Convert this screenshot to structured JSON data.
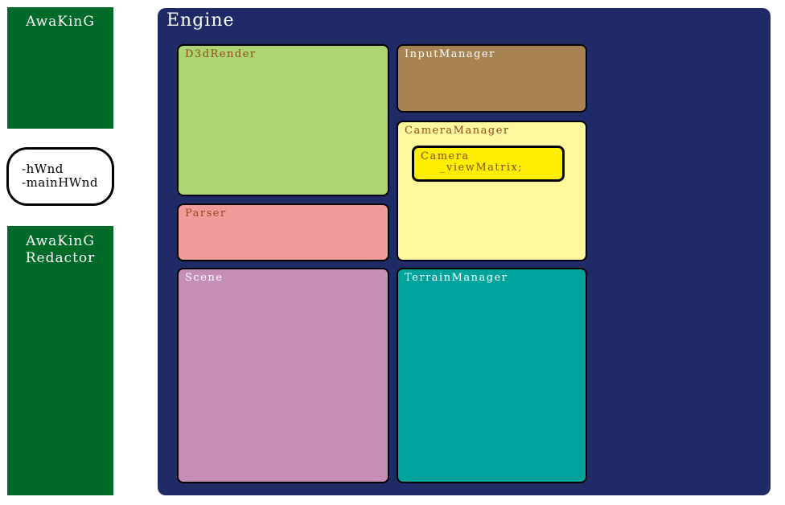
{
  "left": {
    "awaking_label": "AwaKinG",
    "hwnd_lines": [
      "-hWnd",
      "-mainHWnd"
    ],
    "redactor_lines": [
      "AwaKinG",
      "Redactor"
    ]
  },
  "engine": {
    "title": "Engine",
    "modules": {
      "d3drender": "D3dRender",
      "input_manager": "InputManager",
      "camera_manager": "CameraManager",
      "parser": "Parser",
      "scene": "Scene",
      "terrain_manager": "TerrainManager"
    },
    "camera": {
      "lines": [
        "Camera",
        "_viewMatrix;"
      ]
    }
  },
  "colors": {
    "green": "#006b28",
    "engine_bg": "#1f2b67",
    "d3drender": "#acd470",
    "input_manager": "#a88352",
    "camera_manager": "#fff89c",
    "camera": "#ffee00",
    "parser": "#f29c99",
    "scene": "#c68db6",
    "terrain_manager": "#00a49c"
  }
}
